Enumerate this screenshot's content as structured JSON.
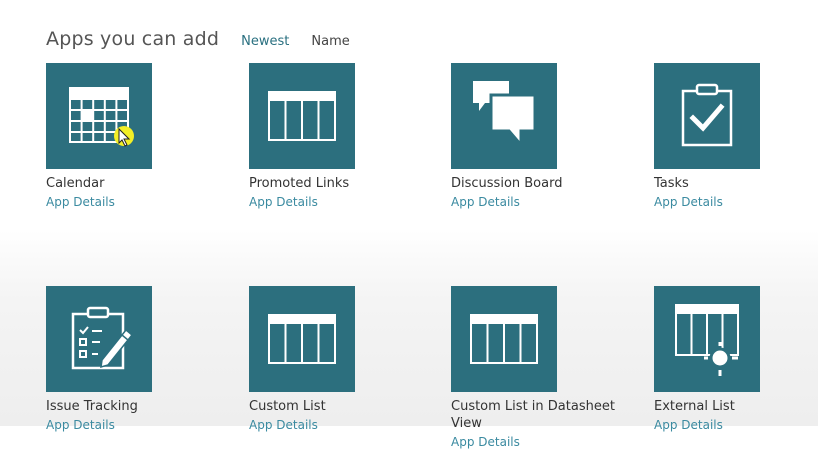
{
  "header": {
    "title": "Apps you can add",
    "sort_newest": "Newest",
    "sort_name": "Name"
  },
  "colors": {
    "tile_background": "#2c6f7e",
    "link": "#3a8aa0",
    "active_sort": "#2a7080",
    "cursor_highlight": "#f3ef26"
  },
  "apps": [
    {
      "title": "Calendar",
      "details": "App Details",
      "icon": "calendar-icon"
    },
    {
      "title": "Promoted Links",
      "details": "App Details",
      "icon": "promoted-links-icon"
    },
    {
      "title": "Discussion Board",
      "details": "App Details",
      "icon": "discussion-board-icon"
    },
    {
      "title": "Tasks",
      "details": "App Details",
      "icon": "tasks-icon"
    },
    {
      "title": "Issue Tracking",
      "details": "App Details",
      "icon": "issue-tracking-icon"
    },
    {
      "title": "Custom List",
      "details": "App Details",
      "icon": "custom-list-icon"
    },
    {
      "title": "Custom List in Datasheet View",
      "details": "App Details",
      "icon": "datasheet-list-icon"
    },
    {
      "title": "External List",
      "details": "App Details",
      "icon": "external-list-icon"
    }
  ]
}
